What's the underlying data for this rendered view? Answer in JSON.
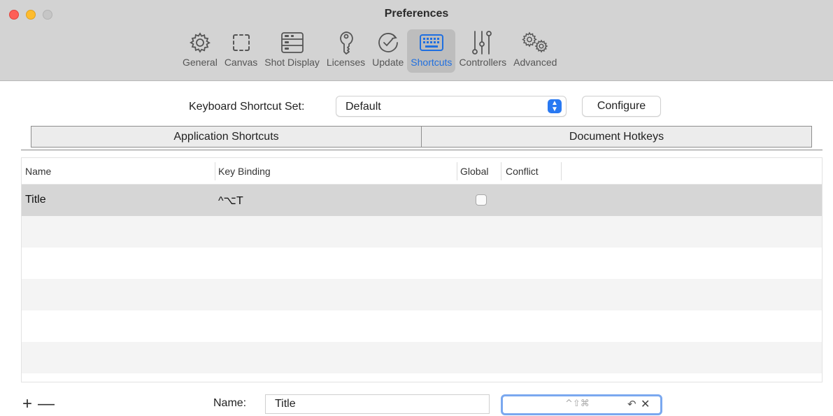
{
  "window": {
    "title": "Preferences"
  },
  "toolbar": {
    "items": [
      {
        "label": "General",
        "icon": "gear-icon"
      },
      {
        "label": "Canvas",
        "icon": "canvas-icon"
      },
      {
        "label": "Shot Display",
        "icon": "shot-display-icon"
      },
      {
        "label": "Licenses",
        "icon": "key-icon"
      },
      {
        "label": "Update",
        "icon": "checkmark-circle-icon"
      },
      {
        "label": "Shortcuts",
        "icon": "keyboard-icon",
        "selected": true
      },
      {
        "label": "Controllers",
        "icon": "sliders-icon"
      },
      {
        "label": "Advanced",
        "icon": "gears-icon"
      }
    ],
    "accent_color": "#1f6fe0"
  },
  "shortcut_set": {
    "label": "Keyboard Shortcut Set:",
    "value": "Default",
    "configure_label": "Configure"
  },
  "tabs": [
    {
      "label": "Application Shortcuts",
      "selected": true
    },
    {
      "label": "Document Hotkeys",
      "selected": false
    }
  ],
  "table": {
    "columns": [
      "Name",
      "Key Binding",
      "Global",
      "Conflict"
    ],
    "rows": [
      {
        "name": "Title",
        "binding": "^⌥T",
        "global": false,
        "conflict": ""
      }
    ]
  },
  "footer": {
    "add_label": "+",
    "remove_label": "—",
    "name_label": "Name:",
    "name_value": "Title",
    "key_modifiers": "^⇧⌘",
    "undo_glyph": "↶",
    "clear_glyph": "✕"
  }
}
